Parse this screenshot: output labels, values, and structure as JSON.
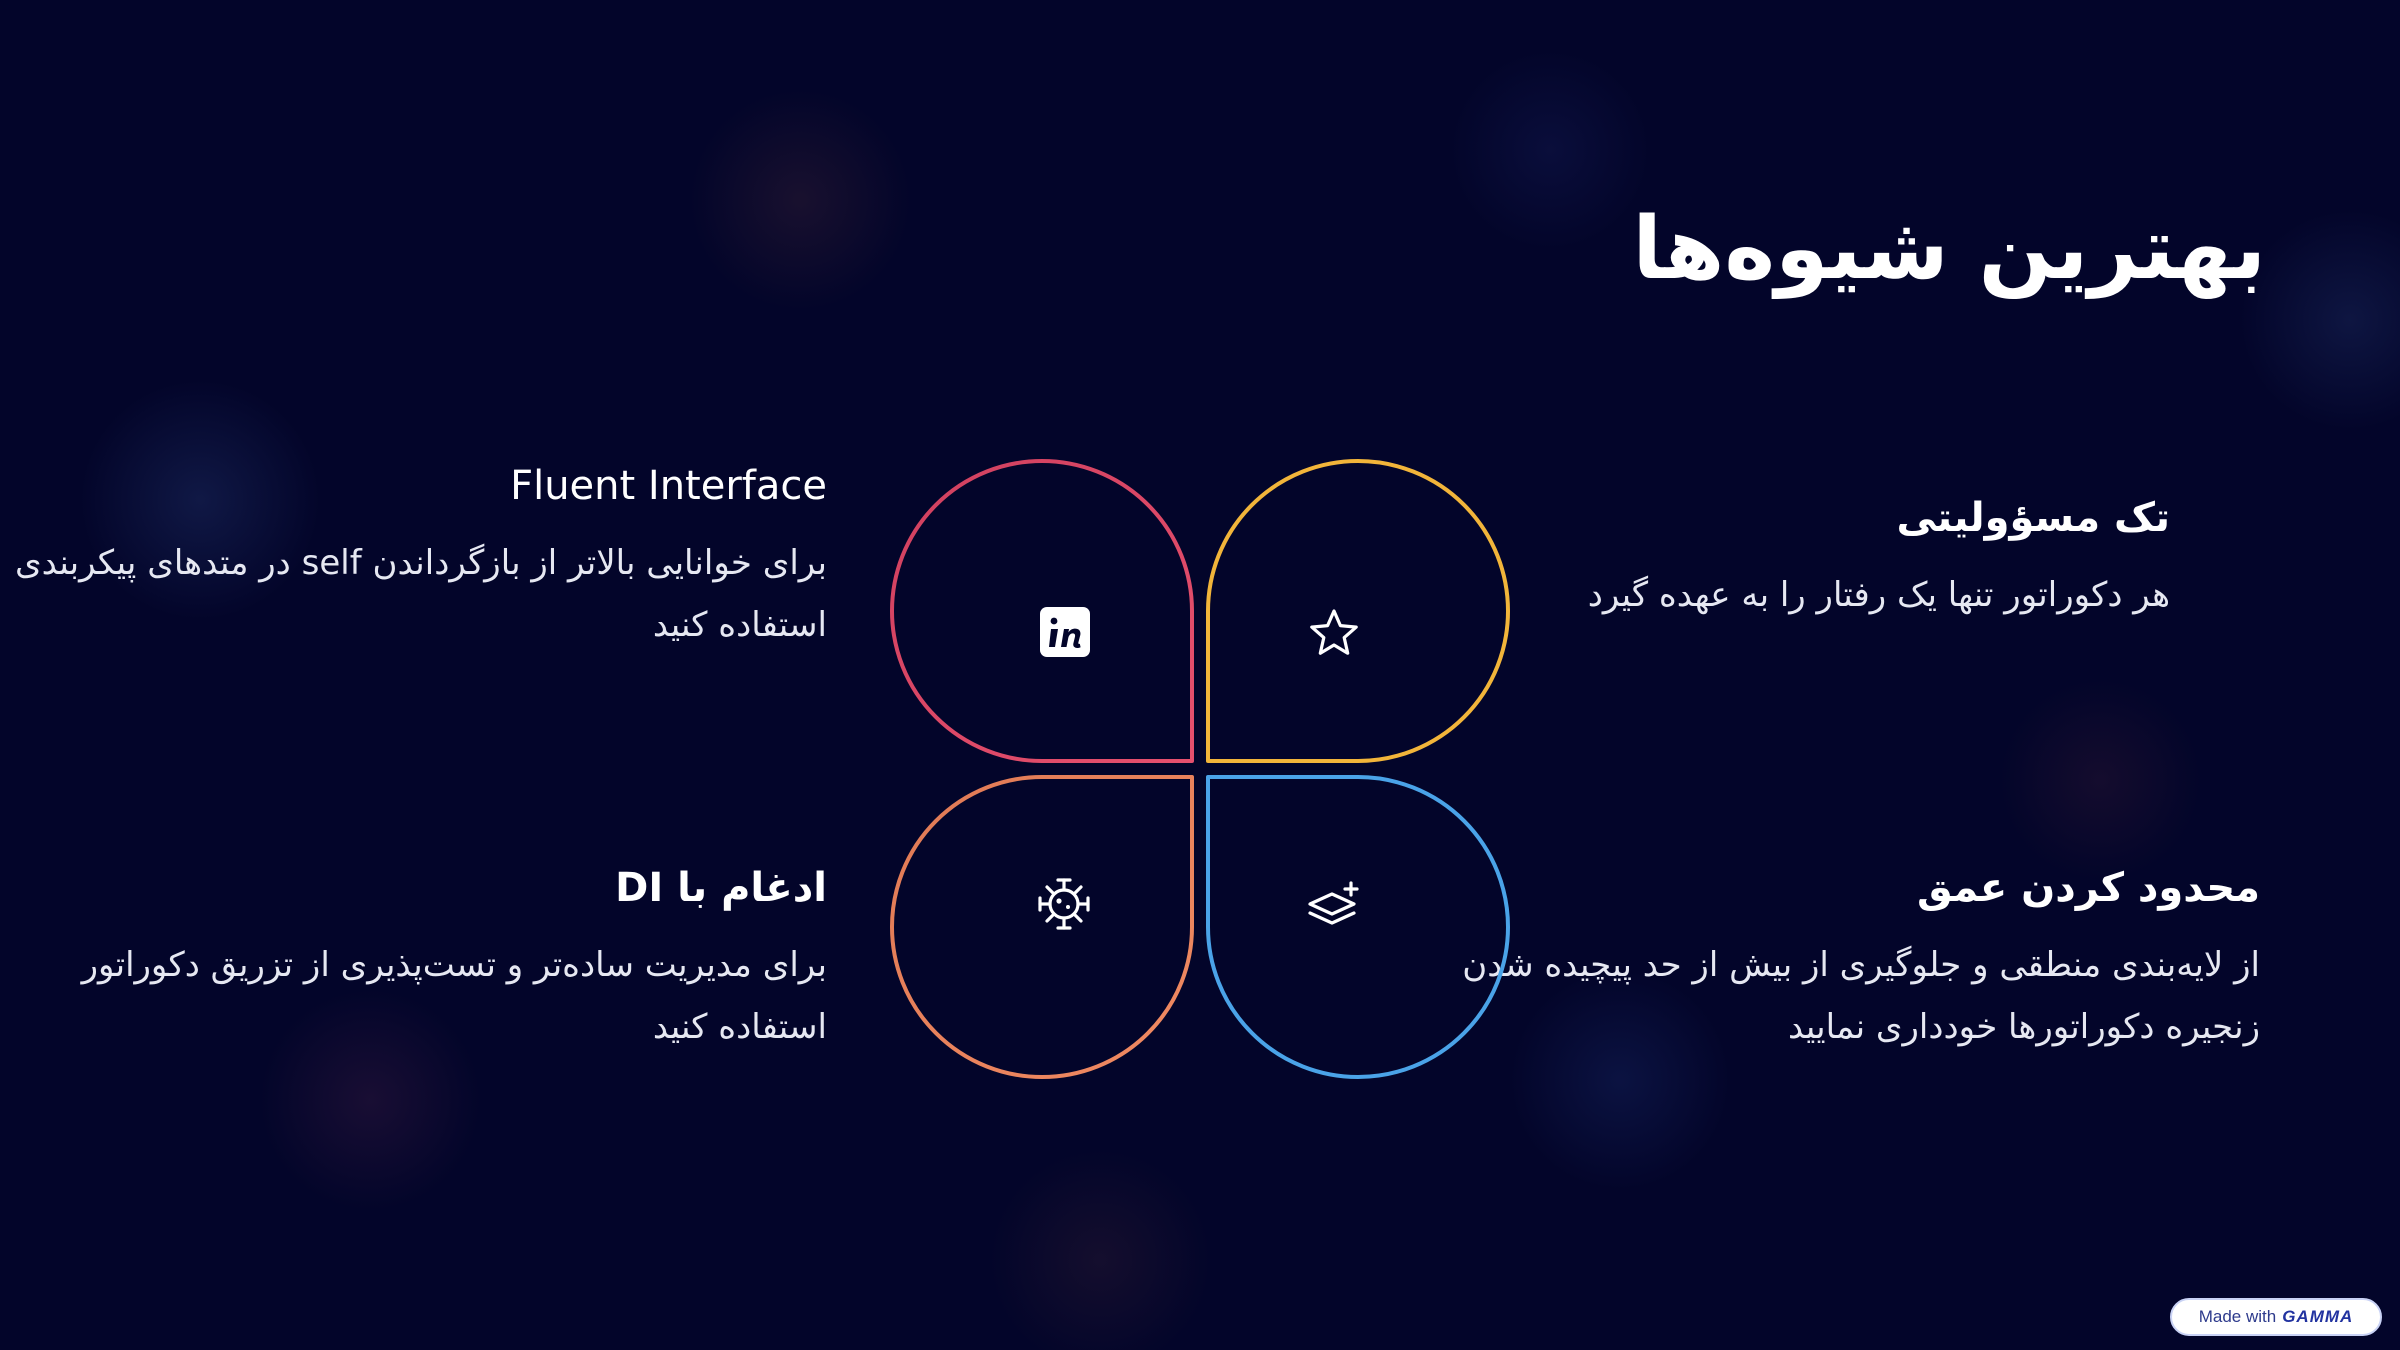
{
  "slide": {
    "title": "بهترین شیوه‌ها"
  },
  "items": {
    "top_left": {
      "heading": "Fluent Interface",
      "body": "برای خوانایی بالاتر از بازگرداندن self در متدهای پیکربندی استفاده کنید",
      "color": "#e0446a",
      "icon": "invision-icon"
    },
    "top_right": {
      "heading": "تک مسؤولیتی",
      "body": "هر دکوراتور تنها یک رفتار را به عهده گیرد",
      "color": "#f2b53a",
      "icon": "star-icon"
    },
    "bottom_left": {
      "heading": "ادغام با DI",
      "body": "برای مدیریت ساده‌تر و تست‌پذیری از تزریق دکوراتور استفاده کنید",
      "color": "#ea7a5a",
      "icon": "virus-icon"
    },
    "bottom_right": {
      "heading": "محدود کردن عمق",
      "body": "از لایه‌بندی منطقی و جلوگیری از بیش از حد پیچیده شدن زنجیره دکوراتورها خودداری نمایید",
      "color": "#4aa3e8",
      "icon": "layers-plus-icon"
    }
  },
  "badge": {
    "prefix": "Made with",
    "brand": "GAMMA"
  }
}
